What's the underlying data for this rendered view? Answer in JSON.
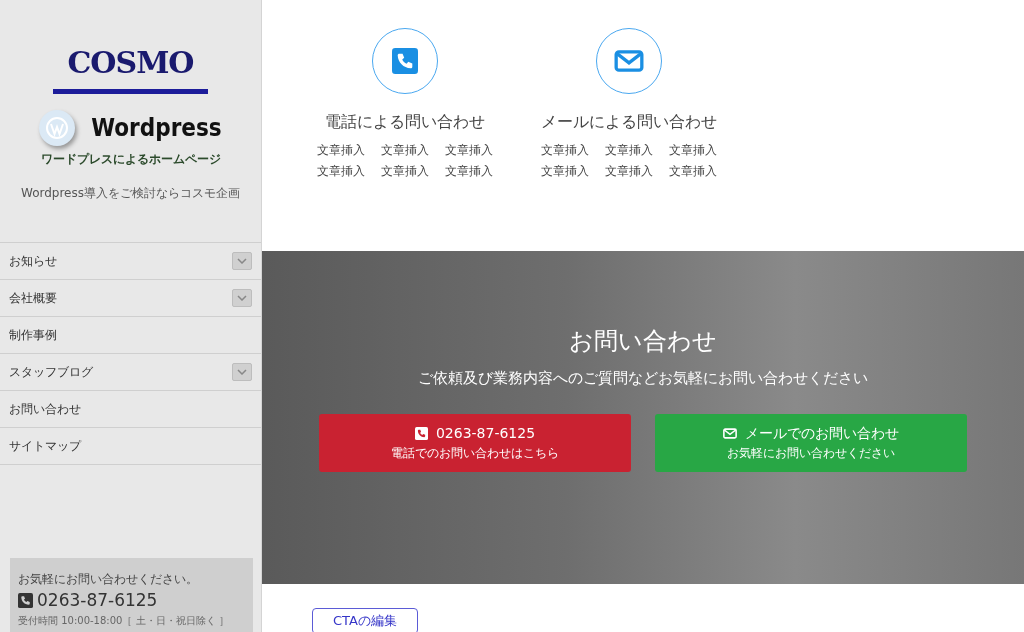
{
  "sidebar": {
    "logo_text": "COSMO",
    "product_text": "Wordpress",
    "logo_caption": "ワードプレスによるホームページ",
    "tagline": "Wordpress導入をご検討ならコスモ企画",
    "menu": [
      {
        "label": "お知らせ",
        "has_submenu": true
      },
      {
        "label": "会社概要",
        "has_submenu": true
      },
      {
        "label": "制作事例",
        "has_submenu": false
      },
      {
        "label": "スタッフブログ",
        "has_submenu": true
      },
      {
        "label": "お問い合わせ",
        "has_submenu": false
      },
      {
        "label": "サイトマップ",
        "has_submenu": false
      }
    ],
    "contact_box": {
      "lead": "お気軽にお問い合わせください。",
      "phone": "0263-87-6125",
      "hours": "受付時間 10:00-18:00［ 土・日・祝日除く ］"
    }
  },
  "contact_methods": [
    {
      "kind": "phone",
      "title": "電話による問い合わせ",
      "lines": [
        [
          "文章挿入",
          "文章挿入",
          "文章挿入"
        ],
        [
          "文章挿入",
          "文章挿入",
          "文章挿入"
        ]
      ]
    },
    {
      "kind": "mail",
      "title": "メールによる問い合わせ",
      "lines": [
        [
          "文章挿入",
          "文章挿入",
          "文章挿入"
        ],
        [
          "文章挿入",
          "文章挿入",
          "文章挿入"
        ]
      ]
    }
  ],
  "cta": {
    "title": "お問い合わせ",
    "subtitle": "ご依頼及び業務内容へのご質問などお気軽にお問い合わせください",
    "buttons": [
      {
        "kind": "phone",
        "label": "0263-87-6125",
        "sub": "電話でのお問い合わせはこちら"
      },
      {
        "kind": "mail",
        "label": "メールでのお問い合わせ",
        "sub": "お気軽にお問い合わせください"
      }
    ],
    "edit_button": "CTAの編集"
  }
}
